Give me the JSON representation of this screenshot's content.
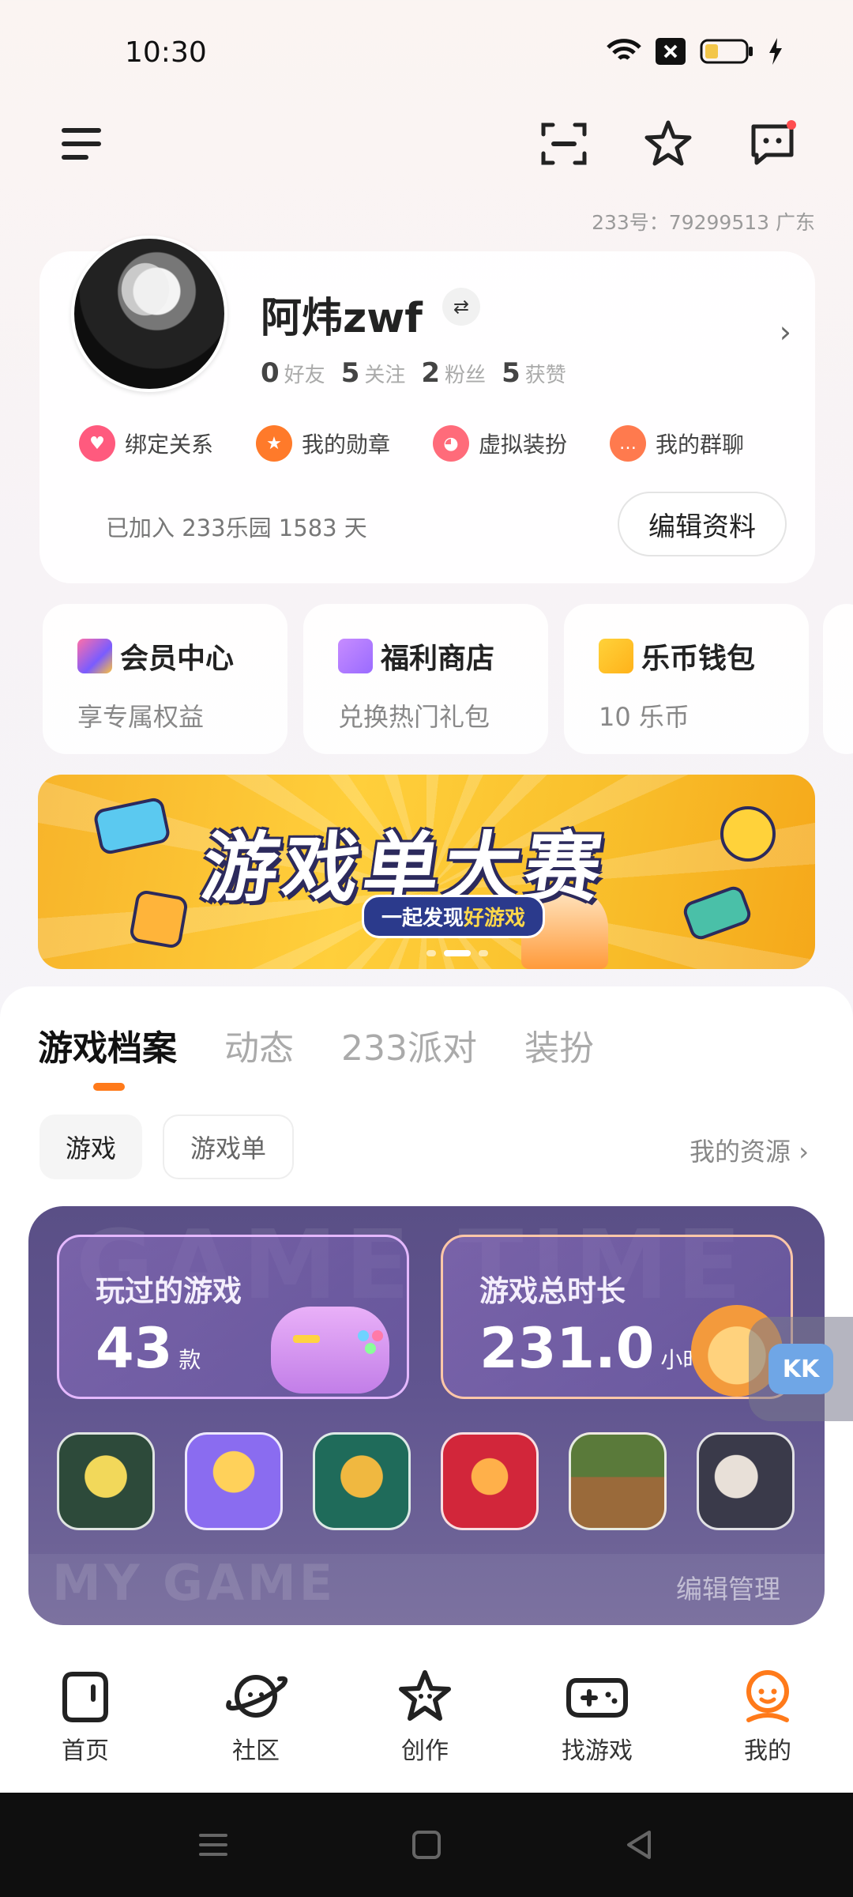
{
  "status_bar": {
    "time": "10:30"
  },
  "header": {
    "id_line": "233号：79299513    广东"
  },
  "profile": {
    "name": "阿炜zwf",
    "stats": [
      {
        "num": "0",
        "label": "好友"
      },
      {
        "num": "5",
        "label": "关注"
      },
      {
        "num": "2",
        "label": "粉丝"
      },
      {
        "num": "5",
        "label": "获赞"
      }
    ],
    "quick_actions": [
      {
        "label": "绑定关系",
        "color": "#ff5a7e",
        "icon": "heart-icon"
      },
      {
        "label": "我的勋章",
        "color": "#ff7a2a",
        "icon": "medal-icon"
      },
      {
        "label": "虚拟装扮",
        "color": "#ff6b7a",
        "icon": "cat-icon"
      },
      {
        "label": "我的群聊",
        "color": "#ff7a4e",
        "icon": "chat-icon"
      }
    ],
    "joined": "已加入 233乐园 1583 天",
    "edit_label": "编辑资料"
  },
  "features": [
    {
      "title": "会员中心",
      "sub": "享专属权益",
      "icon": "crown-icon"
    },
    {
      "title": "福利商店",
      "sub": "兑换热门礼包",
      "icon": "gift-icon"
    },
    {
      "title": "乐币钱包",
      "sub": "10 乐币",
      "icon": "wallet-icon"
    }
  ],
  "banner": {
    "title": "游戏单大赛",
    "sub_a": "一起发现",
    "sub_b": "好游戏"
  },
  "tabs": [
    "游戏档案",
    "动态",
    "233派对",
    "装扮"
  ],
  "filter": {
    "chip_a": "游戏",
    "chip_b": "游戏单",
    "resources": "我的资源 ›"
  },
  "archive": {
    "bg_text": "GAME TIME",
    "bg_text2": "MY GAME",
    "played_label": "玩过的游戏",
    "played_num": "43",
    "played_unit": "款",
    "time_label": "游戏总时长",
    "time_num": "231.0",
    "time_unit": "小时",
    "edit_manage": "编辑管理",
    "games": [
      {
        "name": "game-1",
        "colors": [
          "#2d4a3a",
          "#f2d85a"
        ]
      },
      {
        "name": "game-2",
        "colors": [
          "#8a6cf0",
          "#ffd15a"
        ]
      },
      {
        "name": "game-3",
        "colors": [
          "#1f6b5a",
          "#f0b840"
        ]
      },
      {
        "name": "game-4",
        "colors": [
          "#d2263a",
          "#ffb04a"
        ]
      },
      {
        "name": "game-5",
        "colors": [
          "#5a7a3a",
          "#9a6a3a"
        ]
      },
      {
        "name": "game-6",
        "colors": [
          "#3a3a4a",
          "#e8e0d8"
        ]
      }
    ]
  },
  "float": {
    "label": "KK"
  },
  "bottom_nav": [
    {
      "label": "首页",
      "icon": "home-icon"
    },
    {
      "label": "社区",
      "icon": "planet-icon"
    },
    {
      "label": "创作",
      "icon": "star-icon"
    },
    {
      "label": "找游戏",
      "icon": "gamepad-icon"
    },
    {
      "label": "我的",
      "icon": "profile-icon"
    }
  ]
}
